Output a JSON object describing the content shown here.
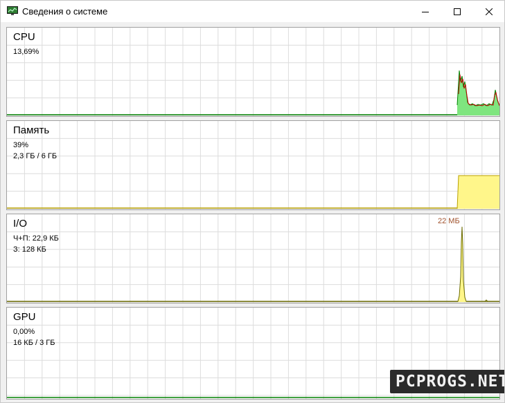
{
  "window": {
    "title": "Сведения о системе",
    "icons": {
      "app": "system-monitor-icon",
      "minimize": "minimize-icon",
      "maximize": "maximize-icon",
      "close": "close-icon"
    }
  },
  "colors": {
    "grid": "#dcdcdc",
    "border": "#a0a0a0",
    "cpu_fill": "#7fe57f",
    "cpu_line": "#008000",
    "cpu_kernel_line": "#c00000",
    "memory_fill": "#fff68a",
    "memory_line": "#b8a000",
    "io_fill": "#fff68a",
    "io_line": "#6b6b00",
    "gpu_line": "#008000",
    "peak_label": "#a0522d"
  },
  "panels": {
    "cpu": {
      "title": "CPU",
      "line1": "13,69%"
    },
    "memory": {
      "title": "Память",
      "line1": "39%",
      "line2": "2,3 ГБ / 6 ГБ"
    },
    "io": {
      "title": "I/O",
      "line1": "Ч+П: 22,9 КБ",
      "line2": "З: 128 КБ",
      "peak_label": "22 МБ"
    },
    "gpu": {
      "title": "GPU",
      "line1": "0,00%",
      "line2": "16 КБ / 3 ГБ"
    }
  },
  "watermark": "PCPROGS.NET"
}
